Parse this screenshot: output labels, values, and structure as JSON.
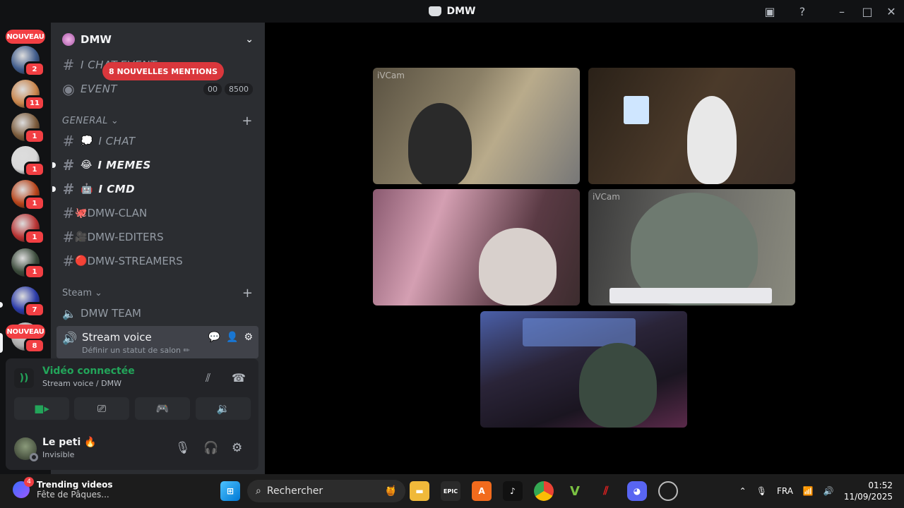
{
  "window": {
    "title": "DMW"
  },
  "rail": {
    "nouveau_top": "NOUVEAU",
    "nouveau_bottom": "NOUVEAU",
    "servers": [
      {
        "badge": "2",
        "color": "#3e5a8a"
      },
      {
        "badge": "11",
        "color": "#c8844a"
      },
      {
        "badge": "1",
        "color": "#7a5a3a"
      },
      {
        "badge": "1",
        "color": "#d8d8d8"
      },
      {
        "badge": "1",
        "color": "#b8441a"
      },
      {
        "badge": "1",
        "color": "#b83232"
      },
      {
        "badge": "1",
        "color": "#3a4a3a"
      },
      {
        "badge": "7",
        "color": "#2a3aa8"
      },
      {
        "badge": "8",
        "color": "#aaaaaa"
      }
    ]
  },
  "sidebar": {
    "guild_name": "DMW",
    "mentions_banner": "8 NOUVELLES MENTIONS",
    "chat_event": "I CHAT-EVENT",
    "event": {
      "label": "EVENT",
      "badge1": "00",
      "badge2": "8500"
    },
    "category_general": "GENERAL",
    "channels": [
      {
        "emoji": "💭",
        "label": "I CHAT"
      },
      {
        "emoji": "😂",
        "label": "I MEMES"
      },
      {
        "emoji": "🤖",
        "label": "I CMD"
      },
      {
        "emoji": "🐙",
        "label": "DMW-CLAN"
      },
      {
        "emoji": "🎥",
        "label": "DMW-EDITERS"
      },
      {
        "emoji": "🔴",
        "label": "DMW-STREAMERS"
      }
    ],
    "category_steam": "Steam",
    "voice_team": "DMW TEAM",
    "stream_voice": {
      "title": "Stream voice",
      "subtitle": "Définir un statut de salon ✏"
    }
  },
  "voice_panel": {
    "status": "Vidéo connectée",
    "location": "Stream voice / DMW"
  },
  "user_panel": {
    "name": "Le peti 🔥",
    "status": "Invisible"
  },
  "video": {
    "tile1_tag": "iVCam",
    "tile4_tag": "iVCam"
  },
  "taskbar": {
    "widget_title": "Trending videos",
    "widget_sub": "Fête de Pâques...",
    "widget_badge": "4",
    "search_placeholder": "Rechercher",
    "epic_label": "EPIC",
    "lang": "FRA",
    "time": "01:52",
    "date": "11/09/2025"
  },
  "colors": {
    "accent_green": "#23a55a",
    "badge_red": "#f23f43",
    "blurple": "#5865f2"
  }
}
